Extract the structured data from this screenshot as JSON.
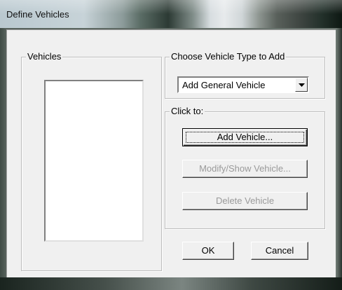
{
  "window": {
    "title": "Define Vehicles"
  },
  "vehicles_group": {
    "label": "Vehicles",
    "items": []
  },
  "vehicle_type_group": {
    "label": "Choose Vehicle Type to Add",
    "selected_type": "Add General Vehicle"
  },
  "click_to_group": {
    "label": "Click to:",
    "add_label": "Add Vehicle...",
    "modify_label": "Modify/Show Vehicle...",
    "delete_label": "Delete Vehicle"
  },
  "actions": {
    "ok_label": "OK",
    "cancel_label": "Cancel"
  },
  "icons": {
    "combo_arrow": "chevron-down-icon"
  }
}
